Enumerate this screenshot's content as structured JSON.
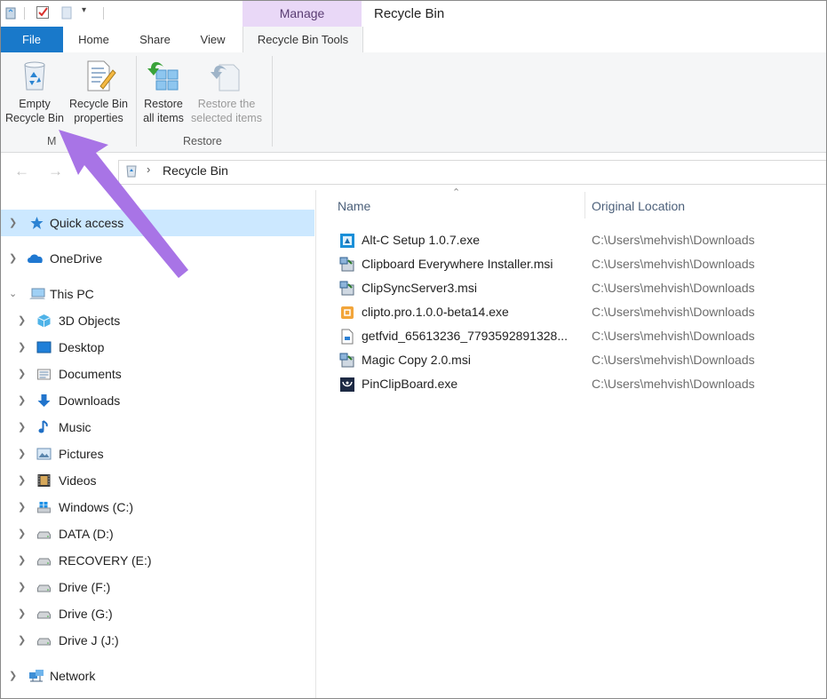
{
  "window": {
    "title": "Recycle Bin",
    "context_tab_group": "Manage"
  },
  "ribbon": {
    "tabs": [
      "File",
      "Home",
      "Share",
      "View",
      "Recycle Bin Tools"
    ],
    "manage_group": {
      "label": "M",
      "buttons": [
        {
          "label_line1": "Empty",
          "label_line2": "Recycle Bin",
          "icon": "recycle-bin-icon"
        },
        {
          "label_line1": "Recycle Bin",
          "label_line2": "properties",
          "icon": "properties-icon"
        }
      ]
    },
    "restore_group": {
      "label": "Restore",
      "buttons": [
        {
          "label_line1": "Restore",
          "label_line2": "all items",
          "icon": "restore-all-icon"
        },
        {
          "label_line1": "Restore the",
          "label_line2": "selected items",
          "icon": "restore-selected-icon",
          "disabled": true
        }
      ]
    }
  },
  "address": {
    "path": "Recycle Bin"
  },
  "nav": {
    "items": [
      {
        "label": "Quick access",
        "icon": "star-icon",
        "expanded": false,
        "selected": true
      },
      {
        "label": "OneDrive",
        "icon": "cloud-icon",
        "expanded": false
      },
      {
        "label": "This PC",
        "icon": "computer-icon",
        "expanded": true
      },
      {
        "label": "3D Objects",
        "icon": "cube-icon"
      },
      {
        "label": "Desktop",
        "icon": "desktop-icon"
      },
      {
        "label": "Documents",
        "icon": "documents-icon"
      },
      {
        "label": "Downloads",
        "icon": "download-arrow-icon"
      },
      {
        "label": "Music",
        "icon": "music-note-icon"
      },
      {
        "label": "Pictures",
        "icon": "pictures-icon"
      },
      {
        "label": "Videos",
        "icon": "film-icon"
      },
      {
        "label": "Windows (C:)",
        "icon": "windows-drive-icon"
      },
      {
        "label": "DATA (D:)",
        "icon": "drive-icon"
      },
      {
        "label": "RECOVERY (E:)",
        "icon": "drive-icon"
      },
      {
        "label": "Drive (F:)",
        "icon": "drive-icon"
      },
      {
        "label": "Drive (G:)",
        "icon": "drive-icon"
      },
      {
        "label": "Drive J (J:)",
        "icon": "drive-icon"
      },
      {
        "label": "Network",
        "icon": "network-icon",
        "expanded": false
      }
    ]
  },
  "files": {
    "columns": [
      "Name",
      "Original Location"
    ],
    "rows": [
      {
        "name": "Alt-C Setup 1.0.7.exe",
        "location": "C:\\Users\\mehvish\\Downloads",
        "icon": "setup-exe-icon"
      },
      {
        "name": "Clipboard Everywhere Installer.msi",
        "location": "C:\\Users\\mehvish\\Downloads",
        "icon": "msi-installer-icon"
      },
      {
        "name": "ClipSyncServer3.msi",
        "location": "C:\\Users\\mehvish\\Downloads",
        "icon": "msi-installer-icon"
      },
      {
        "name": "clipto.pro.1.0.0-beta14.exe",
        "location": "C:\\Users\\mehvish\\Downloads",
        "icon": "orange-exe-icon"
      },
      {
        "name": "getfvid_65613236_7793592891328...",
        "location": "C:\\Users\\mehvish\\Downloads",
        "icon": "file-icon"
      },
      {
        "name": "Magic Copy 2.0.msi",
        "location": "C:\\Users\\mehvish\\Downloads",
        "icon": "msi-installer-icon"
      },
      {
        "name": "PinClipBoard.exe",
        "location": "C:\\Users\\mehvish\\Downloads",
        "icon": "app-exe-icon"
      }
    ]
  },
  "colors": {
    "accent": "#1979ca",
    "selection": "#cce8ff",
    "manage_tab": "#e9d8f7",
    "annotation_arrow": "#a874e6"
  }
}
